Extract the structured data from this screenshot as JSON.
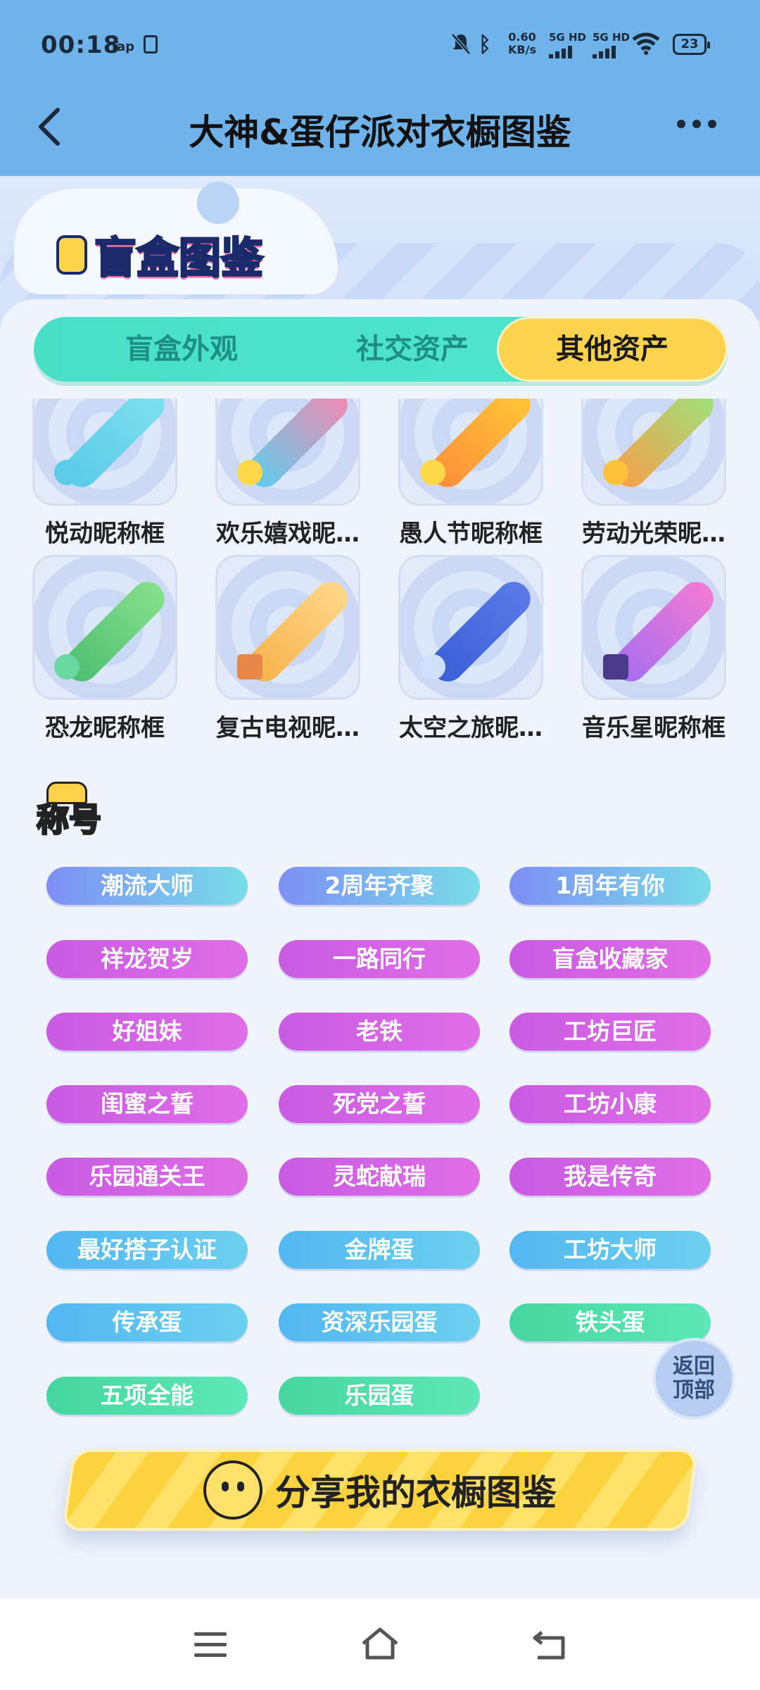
{
  "status_bar": {
    "time": "00:18",
    "app_tag": "Tap",
    "speed_value": "0.60",
    "speed_unit": "KB/s",
    "sim1": "5G HD",
    "sim2": "5G HD",
    "battery": "23"
  },
  "header": {
    "title": "大神&蛋仔派对衣橱图鉴"
  },
  "banner": {
    "heading": "盲盒图鉴"
  },
  "tabs": [
    {
      "label": "盲盒外观",
      "active": false
    },
    {
      "label": "社交资产",
      "active": false
    },
    {
      "label": "其他资产",
      "active": true
    }
  ],
  "frames_row1": [
    {
      "name": "悦动昵称框",
      "color": "#5ccbe8",
      "accent": "#7de0f0"
    },
    {
      "name": "欢乐嬉戏昵…",
      "color": "#f28ab0",
      "accent": "#5fcdee"
    },
    {
      "name": "愚人节昵称框",
      "color": "#ffc636",
      "accent": "#ff8f3a"
    },
    {
      "name": "劳动光荣昵…",
      "color": "#f6a04c",
      "accent": "#9ee07a"
    }
  ],
  "frames_row2": [
    {
      "name": "恐龙昵称框",
      "color": "#86e08a",
      "accent": "#4dbe72"
    },
    {
      "name": "复古电视昵…",
      "color": "#f7b24a",
      "accent": "#ffd78a"
    },
    {
      "name": "太空之旅昵…",
      "color": "#3a5fd6",
      "accent": "#ffd04a"
    },
    {
      "name": "音乐星昵称框",
      "color": "#a66df0",
      "accent": "#f27ad4"
    }
  ],
  "titles_section": {
    "heading": "称号",
    "rows": [
      [
        {
          "label": "潮流大师",
          "style": "blue"
        },
        {
          "label": "2周年齐聚",
          "style": "blue"
        },
        {
          "label": "1周年有你",
          "style": "blue"
        }
      ],
      [
        {
          "label": "祥龙贺岁",
          "style": "purple"
        },
        {
          "label": "一路同行",
          "style": "purple"
        },
        {
          "label": "盲盒收藏家",
          "style": "purple"
        }
      ],
      [
        {
          "label": "好姐妹",
          "style": "purple"
        },
        {
          "label": "老铁",
          "style": "purple"
        },
        {
          "label": "工坊巨匠",
          "style": "purple"
        }
      ],
      [
        {
          "label": "闺蜜之誓",
          "style": "purple"
        },
        {
          "label": "死党之誓",
          "style": "purple"
        },
        {
          "label": "工坊小康",
          "style": "purple"
        }
      ],
      [
        {
          "label": "乐园通关王",
          "style": "purple"
        },
        {
          "label": "灵蛇献瑞",
          "style": "purple"
        },
        {
          "label": "我是传奇",
          "style": "purple"
        }
      ],
      [
        {
          "label": "最好搭子认证",
          "style": "sky"
        },
        {
          "label": "金牌蛋",
          "style": "sky"
        },
        {
          "label": "工坊大师",
          "style": "sky"
        }
      ],
      [
        {
          "label": "传承蛋",
          "style": "sky"
        },
        {
          "label": "资深乐园蛋",
          "style": "sky"
        },
        {
          "label": "铁头蛋",
          "style": "green"
        }
      ],
      [
        {
          "label": "五项全能",
          "style": "green"
        },
        {
          "label": "乐园蛋",
          "style": "green"
        }
      ]
    ]
  },
  "back_to_top": {
    "line1": "返回",
    "line2": "顶部"
  },
  "share_button": {
    "label": "分享我的衣橱图鉴"
  },
  "colors": {
    "header_bg": "#6fb3ea",
    "tab_active": "#fcd34d",
    "tab_bar": "#47e0c7",
    "share": "#fcd33f"
  }
}
